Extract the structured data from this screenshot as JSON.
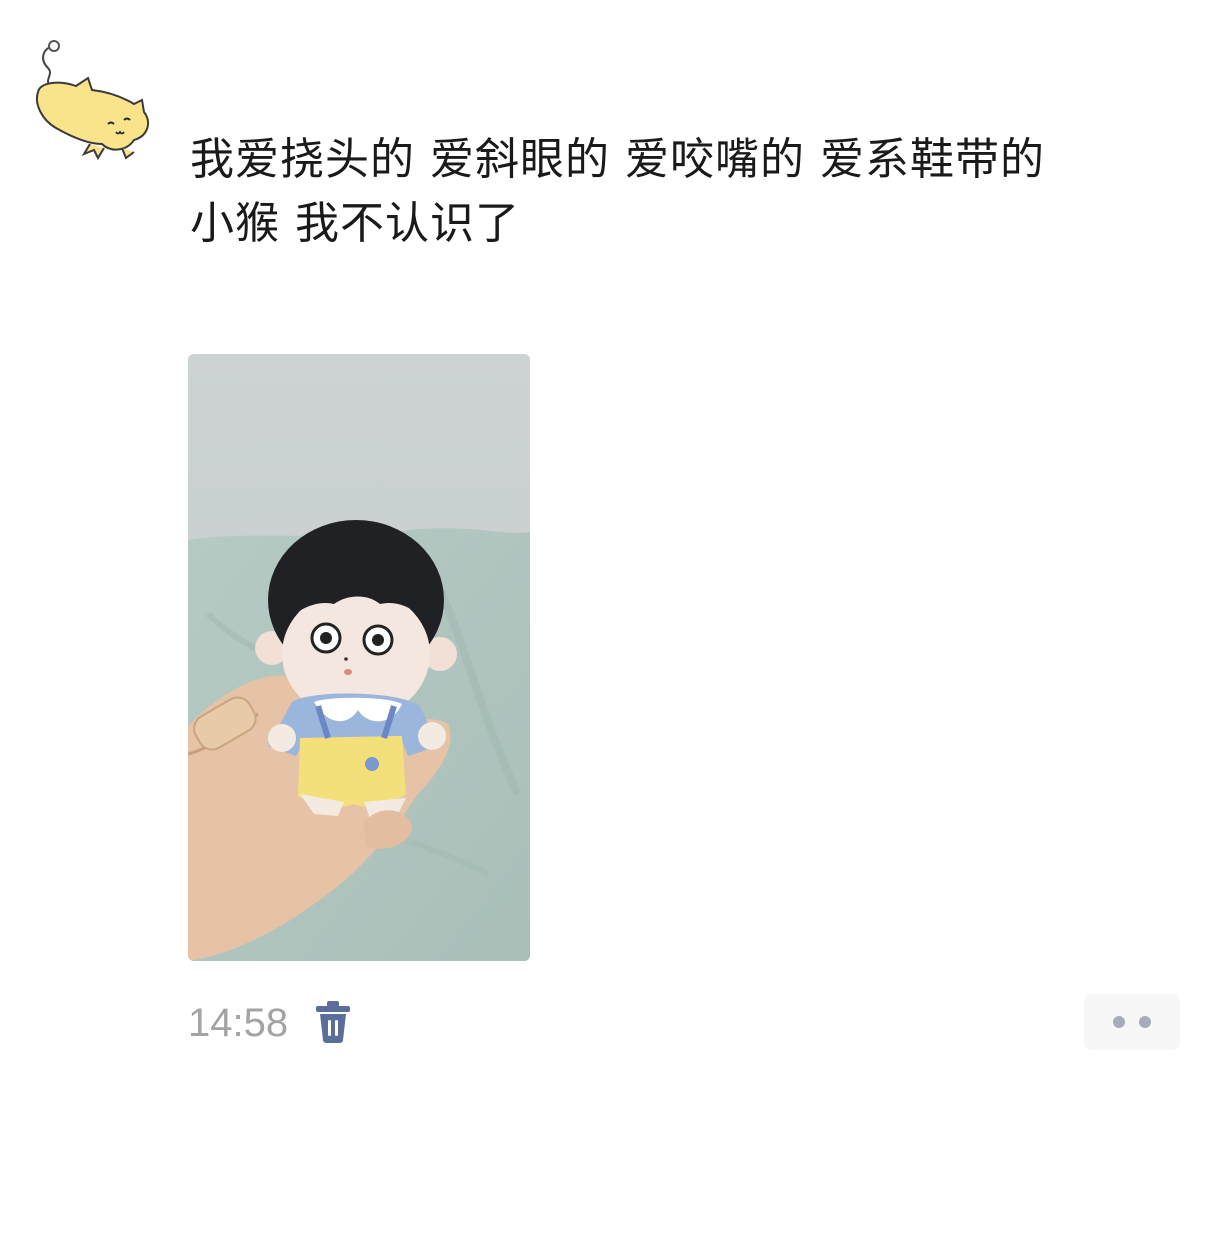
{
  "post": {
    "text_line1": "我爱挠头的 爱斜眼的 爱咬嘴的 爱系鞋带的",
    "text_line2": "小猴 我不认识了",
    "image_description": "",
    "time": "14:58"
  },
  "icons": {
    "avatar": "yellow-cat-avatar",
    "delete": "trash-icon",
    "more": "more-dots-icon"
  },
  "colors": {
    "text": "#1a1a1a",
    "timestamp": "#a3a3a3",
    "delete_icon": "#5b6d99",
    "more_dots": "#a7acb8"
  }
}
